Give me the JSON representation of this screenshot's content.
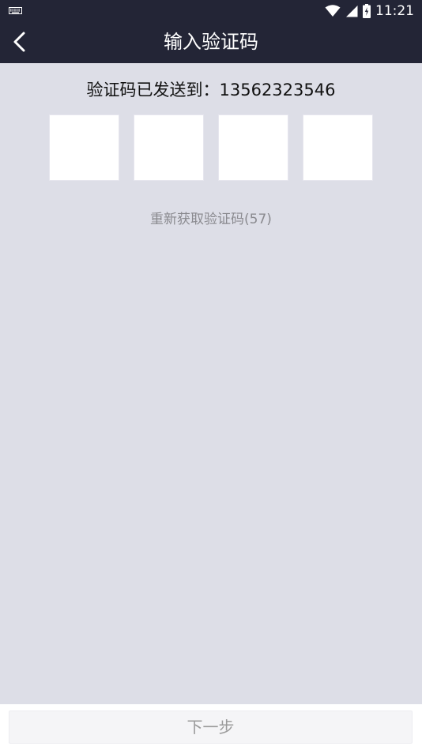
{
  "status_bar": {
    "time": "11:21",
    "icons": [
      "keyboard-icon",
      "wifi-icon",
      "signal-icon",
      "battery-charging-icon"
    ]
  },
  "header": {
    "title": "输入验证码",
    "back_icon": "chevron-left-icon"
  },
  "main": {
    "sent_label": "验证码已发送到：",
    "phone": "13562323546",
    "code_digits": [
      "",
      "",
      "",
      ""
    ],
    "resend_label": "重新获取验证码(57)"
  },
  "footer": {
    "next_label": "下一步"
  },
  "colors": {
    "header_bg": "#232536",
    "page_bg": "#dddee7",
    "box_bg": "#ffffff",
    "muted_text": "#8a8a8f"
  }
}
